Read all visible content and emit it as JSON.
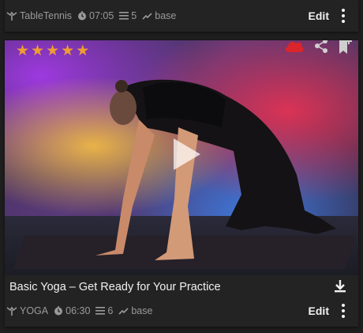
{
  "cards": [
    {
      "category": "TableTennis",
      "duration": "07:05",
      "parts": "5",
      "level": "base",
      "edit_label": "Edit"
    },
    {
      "rating_stars": 5,
      "title": "Basic Yoga – Get Ready for Your Practice",
      "category": "YOGA",
      "duration": "06:30",
      "parts": "6",
      "level": "base",
      "edit_label": "Edit",
      "icons": [
        "cloud-icon",
        "share-icon",
        "bookmark-add-icon",
        "play-icon",
        "download-icon",
        "more-vert-icon"
      ],
      "colors": {
        "star": "#ef9d33",
        "cloud": "#d9252b",
        "text_muted": "#9a9a9a"
      }
    }
  ]
}
